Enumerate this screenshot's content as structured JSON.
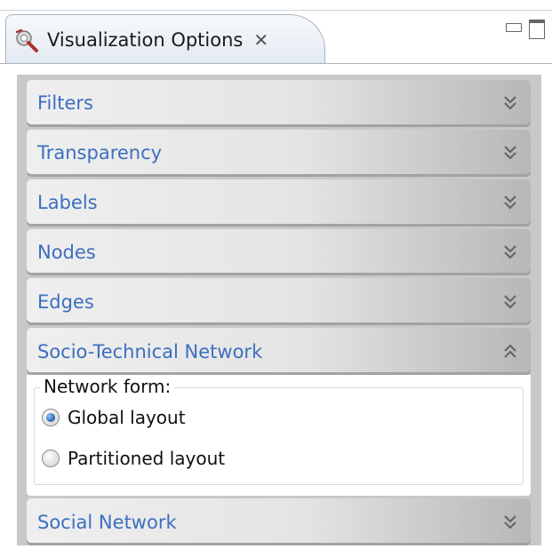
{
  "view": {
    "title": "Visualization Options",
    "close_icon": "close-icon",
    "controls": [
      "minimize-icon",
      "maximize-icon"
    ]
  },
  "sections": [
    {
      "id": "filters",
      "label": "Filters",
      "expanded": false
    },
    {
      "id": "transparency",
      "label": "Transparency",
      "expanded": false
    },
    {
      "id": "labels",
      "label": "Labels",
      "expanded": false
    },
    {
      "id": "nodes",
      "label": "Nodes",
      "expanded": false
    },
    {
      "id": "edges",
      "label": "Edges",
      "expanded": false
    },
    {
      "id": "socio-technical-network",
      "label": "Socio-Technical Network",
      "expanded": true
    },
    {
      "id": "social-network",
      "label": "Social Network",
      "expanded": false
    }
  ],
  "network_form": {
    "label": "Network form:",
    "options": [
      {
        "label": "Global layout",
        "selected": true
      },
      {
        "label": "Partitioned layout",
        "selected": false
      }
    ]
  },
  "colors": {
    "section_title": "#3c6fbf",
    "panel_bg": "#c8c8c8",
    "radio_selected": "#1d4fa3"
  }
}
